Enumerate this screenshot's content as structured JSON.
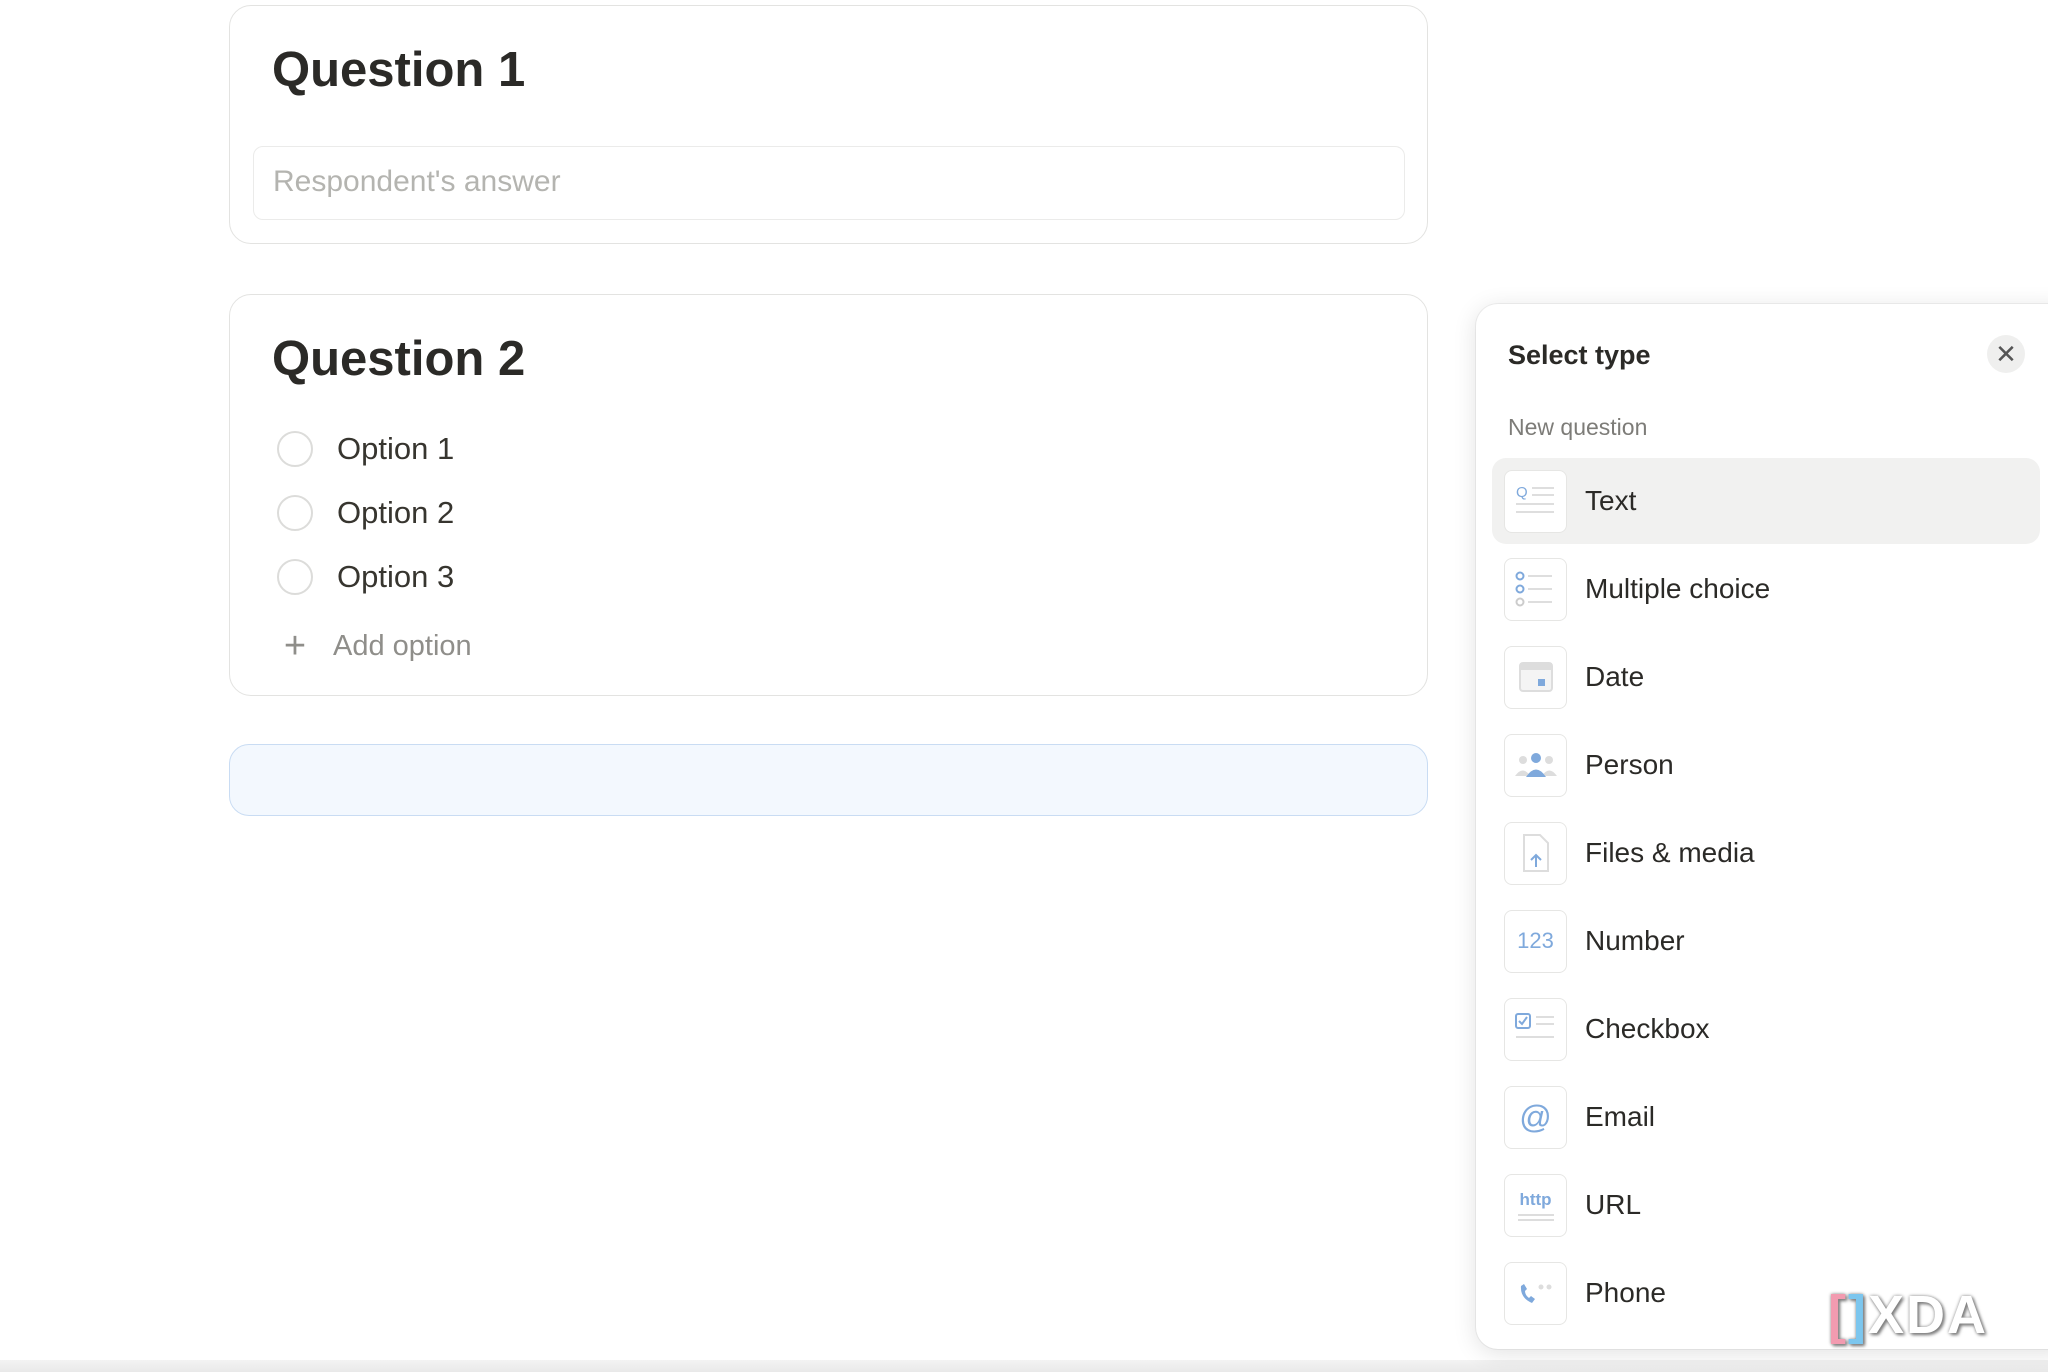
{
  "questions": [
    {
      "title": "Question 1",
      "answer_placeholder": "Respondent's answer"
    },
    {
      "title": "Question 2",
      "options": [
        "Option 1",
        "Option 2",
        "Option 3"
      ],
      "add_option": "Add option"
    }
  ],
  "panel": {
    "title": "Select type",
    "close_icon": "close-icon",
    "section": "New question",
    "items": [
      {
        "label": "Text",
        "icon": "text-question-icon",
        "highlighted": true
      },
      {
        "label": "Multiple choice",
        "icon": "multiple-choice-icon"
      },
      {
        "label": "Date",
        "icon": "calendar-icon"
      },
      {
        "label": "Person",
        "icon": "people-icon"
      },
      {
        "label": "Files & media",
        "icon": "file-upload-icon"
      },
      {
        "label": "Number",
        "icon": "number-icon",
        "glyph": "123"
      },
      {
        "label": "Checkbox",
        "icon": "checkbox-icon"
      },
      {
        "label": "Email",
        "icon": "at-icon",
        "glyph": "@"
      },
      {
        "label": "URL",
        "icon": "http-icon",
        "glyph": "http"
      },
      {
        "label": "Phone",
        "icon": "phone-icon"
      }
    ]
  },
  "watermark": "XDA",
  "colors": {
    "accent": "#7fa9dc",
    "highlight": "#f1f1f0",
    "add_bar": "#f3f8fe"
  }
}
